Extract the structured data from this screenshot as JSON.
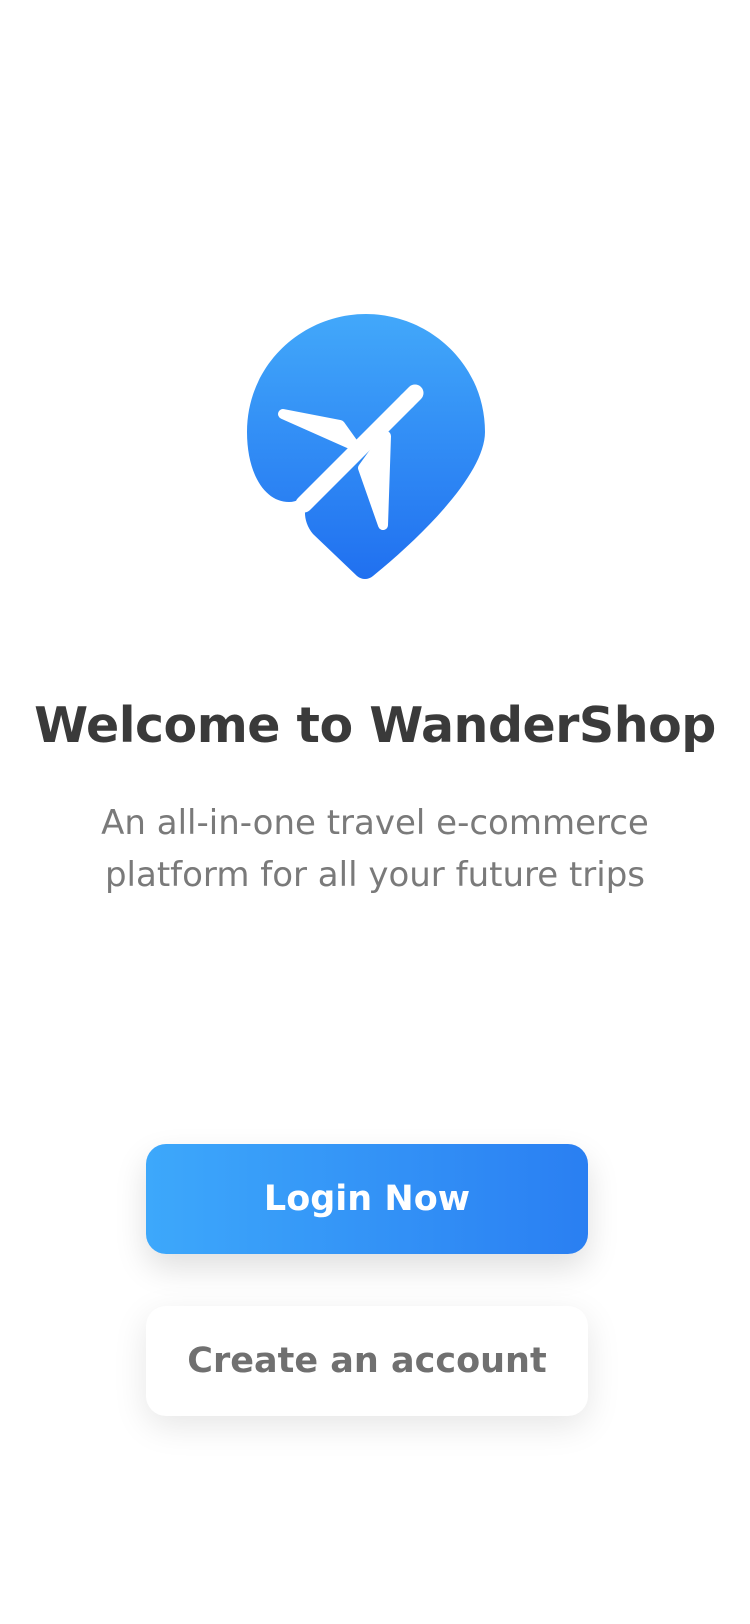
{
  "app": {
    "logo_icon": "airplane-location-pin-icon",
    "brand_colors": {
      "gradient_start": "#42a8fa",
      "gradient_end": "#2070f0",
      "title_text": "#3a3a3a",
      "subtitle_text": "#7a7a7a"
    }
  },
  "welcome": {
    "title": "Welcome to WanderShop",
    "subtitle": "An all-in-one travel e-commerce platform for all your future trips"
  },
  "actions": {
    "login_label": "Login Now",
    "create_account_label": "Create an account"
  }
}
